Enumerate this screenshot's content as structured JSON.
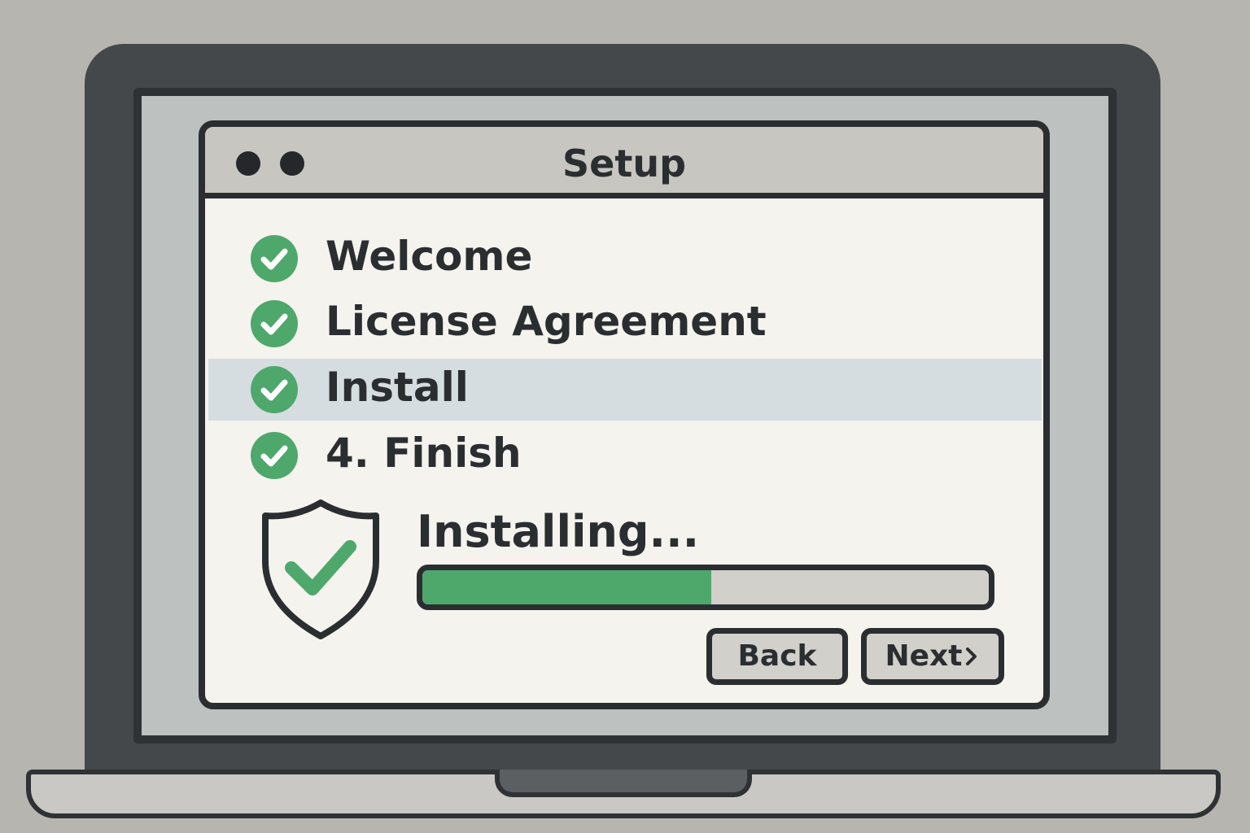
{
  "window": {
    "title": "Setup"
  },
  "steps": [
    {
      "label": "Welcome",
      "completed": true,
      "active": false
    },
    {
      "label": "License Agreement",
      "completed": true,
      "active": false
    },
    {
      "label": "Install",
      "completed": true,
      "active": true
    },
    {
      "label": "4. Finish",
      "completed": true,
      "active": false
    }
  ],
  "install": {
    "status_text": "Installing...",
    "progress": 0.51,
    "shield_icon": "shield-check-icon"
  },
  "buttons": {
    "back_label": "Back",
    "next_label": "Next",
    "next_icon": "chevron-right-icon"
  },
  "colors": {
    "accent_green": "#4ea86b",
    "active_row": "#d5dde0",
    "window_bg": "#f5f3ee",
    "titlebar_bg": "#c8c6c1",
    "frame_dark": "#2b2e31"
  }
}
